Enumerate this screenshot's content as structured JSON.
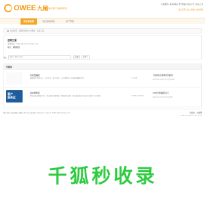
{
  "brand": {
    "logo_text": "OWEE",
    "logo_cn": "九尾",
    "slogan": "送来三星少盘是问状迈",
    "top_links": "九尾聊天 | 看书好站 | 查号快速 | 论坛大全 | 论坛工具",
    "top_links2": "设为首页 | 加入收藏 | 在线客服"
  },
  "nav": {
    "items": [
      {
        "label": "综合版信源",
        "active": true
      },
      {
        "label": "论坛活动动区",
        "active": false
      },
      {
        "label": "资产帮档",
        "active": false
      }
    ]
  },
  "breadcrumb": "九尾社区  ›  资悦拉资佐公众事处  ›  送来三星",
  "forum_info": {
    "title": "送来三星",
    "subtitle": "专题链接：http://bjx.jhc.9owee.com",
    "moderator": "版主：蝴蝶眼见"
  },
  "search": {
    "label": "搜索",
    "placeholder": "请输入搜索关键词 ...",
    "button": "立即",
    "select": "全部 ▾"
  },
  "section": {
    "title": "分版块",
    "rows": [
      {
        "icon": "",
        "title": "论坛送福区",
        "desc": "最新推荐资讯公告 · 公众社告 · 热门活动 · 点击查看第一时间获得最新讯息",
        "count": "3 / 143",
        "last_title": "【送你北京冬季营开报名】",
        "last_meta": "2023-12-28 22:31 用户4502"
      },
      {
        "icon": "客户\n服务区",
        "title": "客户服务区",
        "desc": "网站运营及帮助专区 · 论坛相关问题帮助 · 解答相关问题 · 提交建议意见与回应有关客户关注问题",
        "count": "12356 / 40230",
        "last_title": "[VIP]世晨播报不起了",
        "last_meta": "2023-10-31 16:52 用户88"
      }
    ]
  },
  "footer": {
    "left": "联系我们 | 网站地图 | 帮助 | Board (九尾社区) | Based on Discuz! 2006-2023 9owee.com",
    "right": "导航站 · 九尾网",
    "right2": "GMT+8, 2023-12-30 23:05"
  },
  "watermark": "千狐秒收录",
  "colors": {
    "accent": "#f5a623",
    "brand": "#f39c12",
    "watermark": "#2ecc40",
    "promo": "#1f5c9b"
  }
}
